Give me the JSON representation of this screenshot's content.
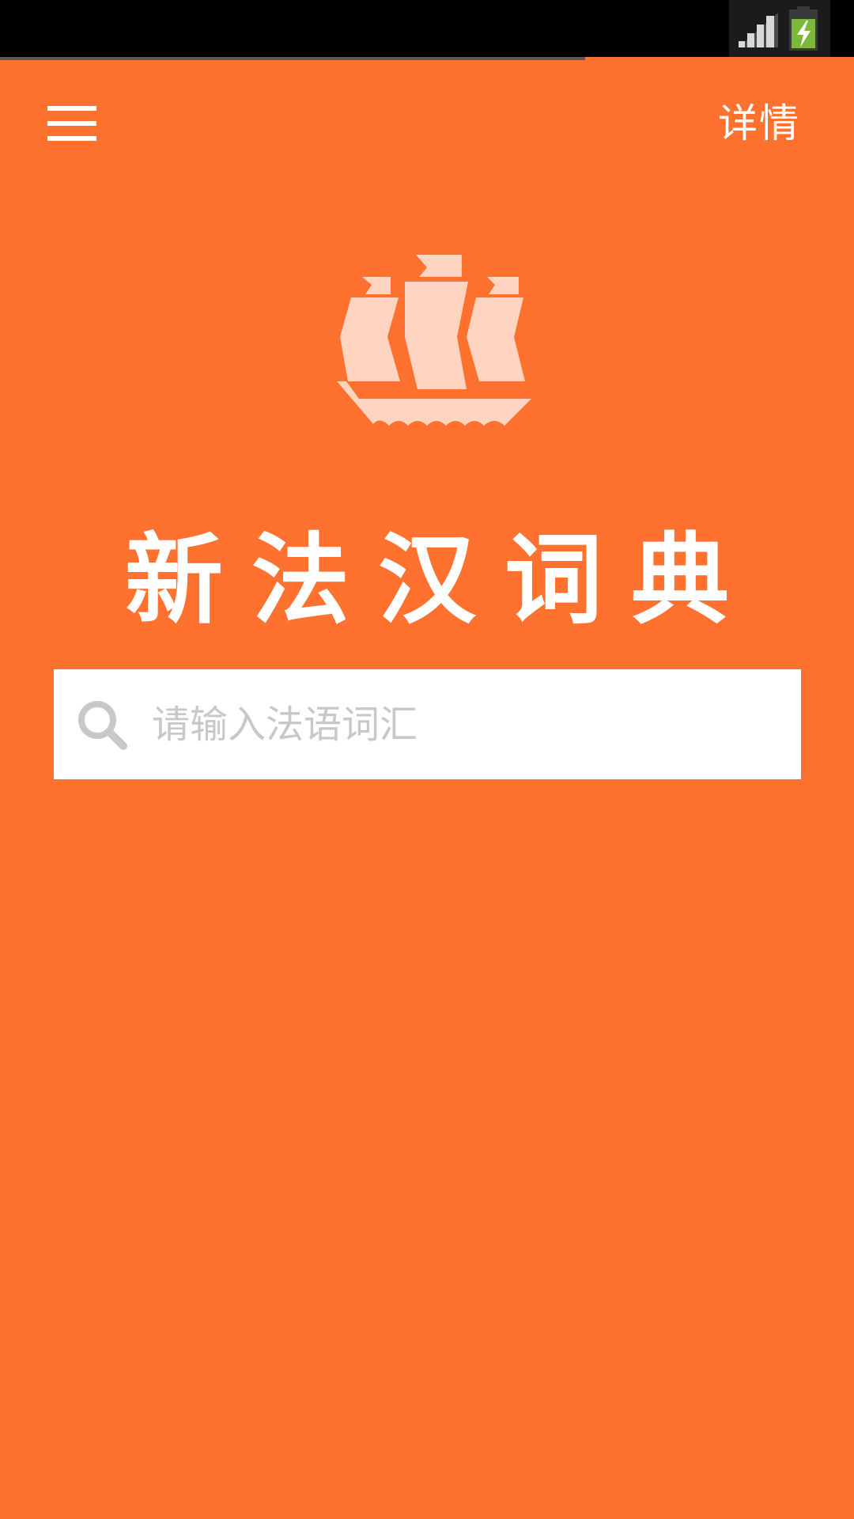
{
  "app": {
    "title": "新法汉词典"
  },
  "toolbar": {
    "details_label": "详情"
  },
  "search": {
    "placeholder": "请输入法语词汇"
  },
  "icons": {
    "menu": "hamburger-menu-icon",
    "logo": "sailing-ship-icon",
    "search": "search-icon",
    "signal": "signal-strength-icon",
    "battery": "battery-charging-icon"
  },
  "colors": {
    "background": "#ff712e",
    "logo": "#ffd5c1",
    "text": "#ffffff",
    "placeholder": "#c8c8c8",
    "search_icon": "#c8c8c8",
    "battery": "#7cb83a"
  }
}
